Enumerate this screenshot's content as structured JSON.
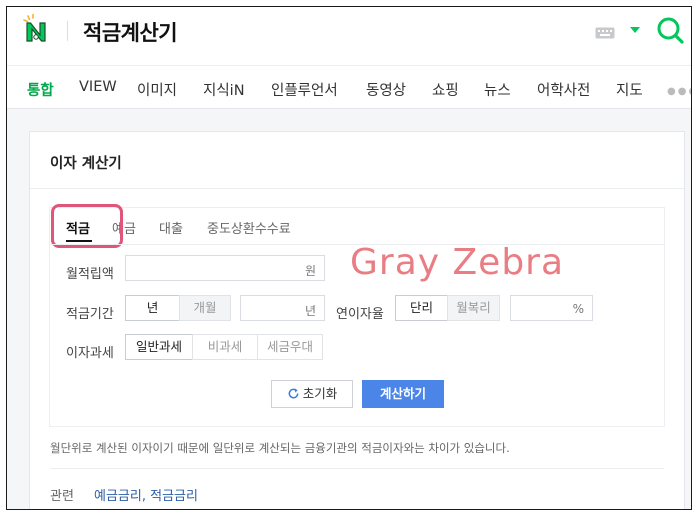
{
  "header": {
    "search_query": "적금계산기"
  },
  "tabs": [
    {
      "label": "통합",
      "active": true
    },
    {
      "label": "VIEW"
    },
    {
      "label": "이미지"
    },
    {
      "label": "지식iN"
    },
    {
      "label": "인플루언서"
    },
    {
      "label": "동영상"
    },
    {
      "label": "쇼핑"
    },
    {
      "label": "뉴스"
    },
    {
      "label": "어학사전"
    },
    {
      "label": "지도"
    }
  ],
  "card": {
    "title": "이자 계산기",
    "calc_tabs": [
      {
        "label": "적금",
        "active": true
      },
      {
        "label": "예금"
      },
      {
        "label": "대출"
      },
      {
        "label": "중도상환수수료"
      }
    ],
    "monthly": {
      "label": "월적립액",
      "unit": "원",
      "value": ""
    },
    "period": {
      "label": "적금기간",
      "opt_year": "년",
      "opt_month": "개월",
      "unit": "년",
      "value": ""
    },
    "rate": {
      "label": "연이자율",
      "opt_simple": "단리",
      "opt_compound": "월복리",
      "unit": "%",
      "value": ""
    },
    "tax": {
      "label": "이자과세",
      "opt_general": "일반과세",
      "opt_exempt": "비과세",
      "opt_preferential": "세금우대"
    },
    "reset_label": "초기화",
    "calc_label": "계산하기",
    "note": "월단위로 계산된 이자이기 때문에 일단위로 계산되는 금융기관의 적금이자와는 차이가 있습니다.",
    "related_label": "관련",
    "related_links": "예금금리, 적금금리"
  },
  "watermark": "Gray Zebra",
  "colors": {
    "brand_green": "#03c75a",
    "active_tab": "#03a94d",
    "calc_button": "#4b85e8",
    "highlight": "#e0567a",
    "link": "#2a5ea8"
  }
}
